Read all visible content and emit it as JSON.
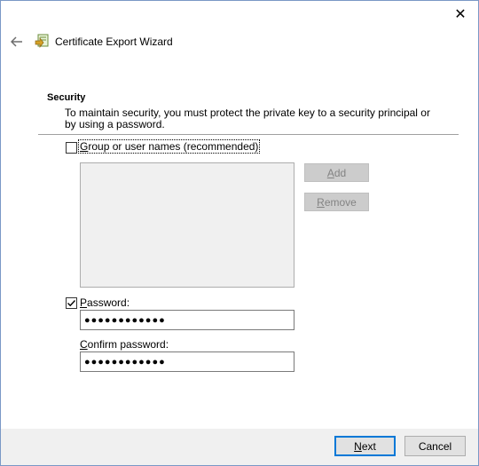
{
  "window": {
    "title": "Certificate Export Wizard",
    "close_glyph": "✕"
  },
  "security": {
    "heading": "Security",
    "description": "To maintain security, you must protect the private key to a security principal or by using a password.",
    "group_option": {
      "label_underlined": "G",
      "label_rest": "roup or user names (recommended)",
      "checked": false
    },
    "add_button": {
      "underlined": "A",
      "rest": "dd",
      "enabled": false
    },
    "remove_button": {
      "underlined": "R",
      "rest": "emove",
      "enabled": false
    },
    "password_option": {
      "label_underlined": "P",
      "label_rest": "assword:",
      "checked": true,
      "value": "●●●●●●●●●●●●"
    },
    "confirm_password": {
      "label_underlined": "C",
      "label_rest": "onfirm password:",
      "value": "●●●●●●●●●●●●"
    }
  },
  "footer": {
    "next": {
      "underlined": "N",
      "rest": "ext"
    },
    "cancel": "Cancel"
  },
  "icons": {
    "back": "back-arrow-icon",
    "close": "close-icon",
    "wizard": "certificate-icon",
    "check": "check-icon"
  }
}
